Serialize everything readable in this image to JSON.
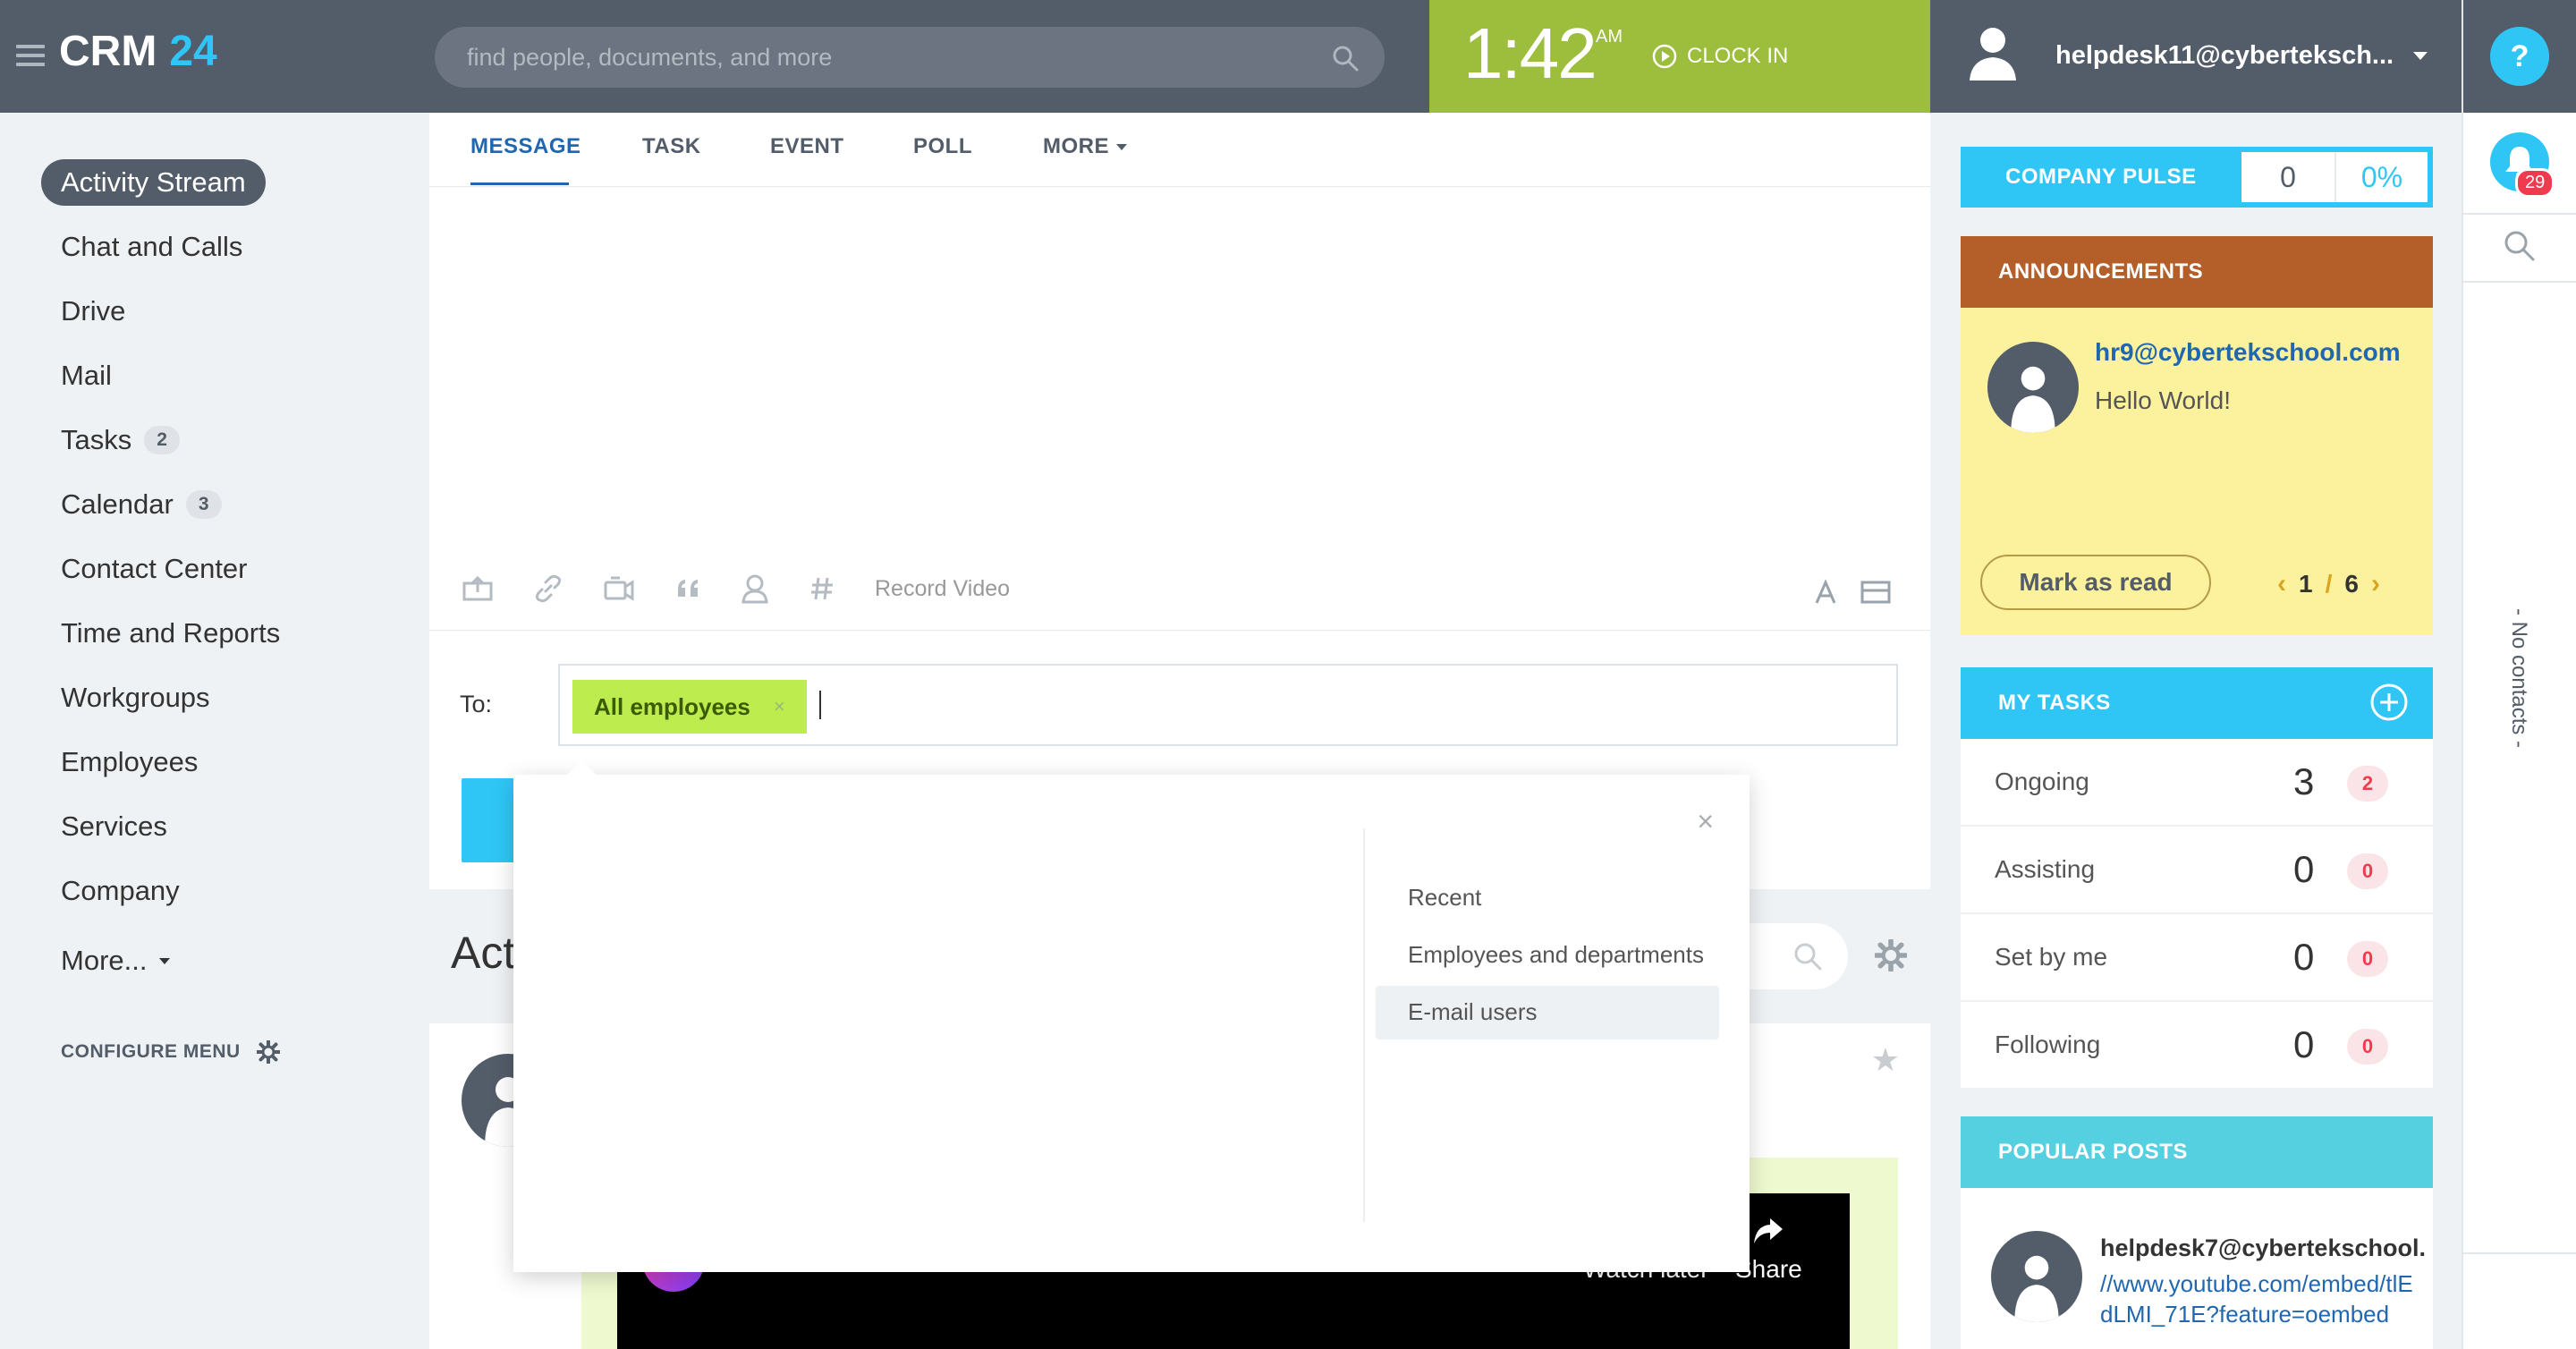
{
  "header": {
    "logo_text": "CRM",
    "logo_number": "24",
    "search_placeholder": "find people, documents, and more",
    "time": "1:42",
    "ampm": "AM",
    "clock_in_label": "CLOCK IN",
    "user_email": "helpdesk11@cyberteksch..."
  },
  "right_panel": {
    "help_label": "?",
    "notification_count": "29",
    "no_contacts_label": "- No contacts -"
  },
  "sidebar": {
    "items": [
      {
        "label": "Activity Stream"
      },
      {
        "label": "Chat and Calls"
      },
      {
        "label": "Drive"
      },
      {
        "label": "Mail"
      },
      {
        "label": "Tasks",
        "badge": "2"
      },
      {
        "label": "Calendar",
        "badge": "3"
      },
      {
        "label": "Contact Center"
      },
      {
        "label": "Time and Reports"
      },
      {
        "label": "Workgroups"
      },
      {
        "label": "Employees"
      },
      {
        "label": "Services"
      },
      {
        "label": "Company"
      },
      {
        "label": "More..."
      }
    ],
    "configure_label": "CONFIGURE MENU"
  },
  "composer": {
    "tabs": [
      {
        "label": "MESSAGE"
      },
      {
        "label": "TASK"
      },
      {
        "label": "EVENT"
      },
      {
        "label": "POLL"
      },
      {
        "label": "MORE"
      }
    ],
    "record_video_label": "Record Video",
    "to_label": "To:",
    "recipient_chip": "All employees",
    "chip_remove": "×"
  },
  "feed": {
    "title": "Act",
    "star": "★",
    "video_watch_later": "Watch later",
    "video_share": "Share"
  },
  "popup": {
    "close": "×",
    "items": [
      {
        "label": "Recent"
      },
      {
        "label": "Employees and departments"
      },
      {
        "label": "E-mail users"
      }
    ]
  },
  "company_pulse": {
    "label": "COMPANY PULSE",
    "value": "0",
    "percent": "0%"
  },
  "announcements": {
    "title": "ANNOUNCEMENTS",
    "author": "hr9@cybertekschool.com",
    "text": "Hello World!",
    "mark_read_label": "Mark as read",
    "page_current": "1",
    "page_sep": "/",
    "page_total": "6",
    "prev": "‹",
    "next": "›"
  },
  "my_tasks": {
    "title": "MY TASKS",
    "rows": [
      {
        "label": "Ongoing",
        "count": "3",
        "badge": "2"
      },
      {
        "label": "Assisting",
        "count": "0",
        "badge": "0"
      },
      {
        "label": "Set by me",
        "count": "0",
        "badge": "0"
      },
      {
        "label": "Following",
        "count": "0",
        "badge": "0"
      }
    ]
  },
  "popular_posts": {
    "title": "POPULAR POSTS",
    "author": "helpdesk7@cybertekschool.",
    "link": "//www.youtube.com/embed/tlEdLMI_71E?feature=oembed"
  },
  "colors": {
    "header_bg": "#535c69",
    "accent_blue": "#2fc6f6",
    "clock_green": "#9dbd3d",
    "announcement_head": "#b45f2a",
    "announcement_bg": "#fcf19d",
    "chip_green": "#bcec4e"
  }
}
